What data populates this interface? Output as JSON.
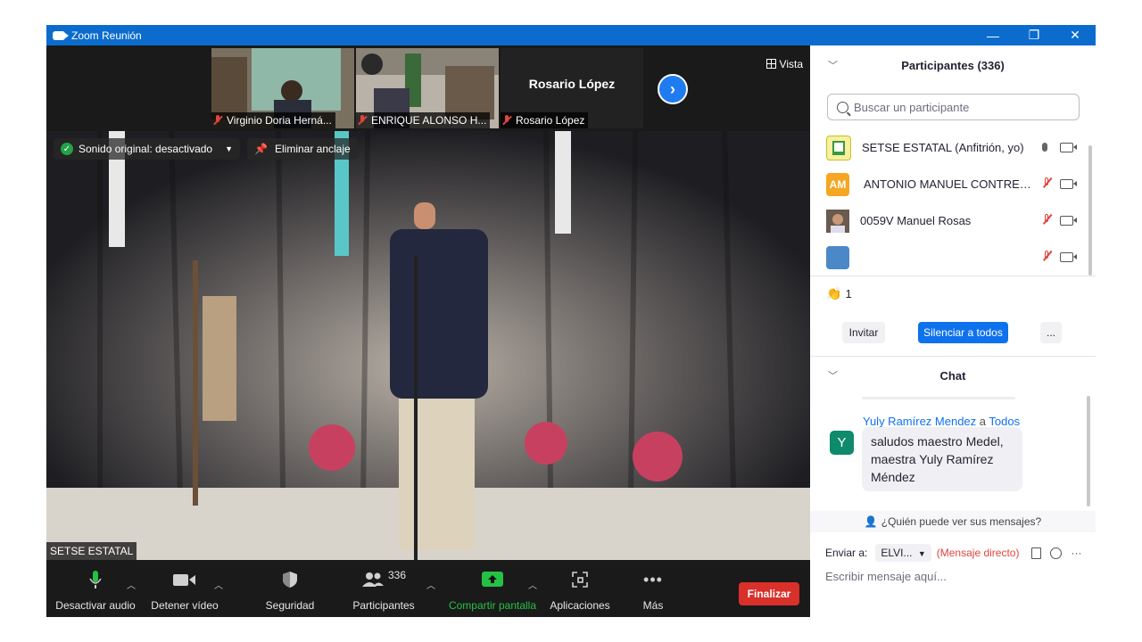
{
  "window": {
    "title": "Zoom Reunión",
    "controls": {
      "minimize": "—",
      "restore": "❐",
      "close": "✕"
    }
  },
  "strip": {
    "thumbnails": [
      {
        "name": "Virginio Doria Herná...",
        "muted": true
      },
      {
        "name": "ENRIQUE ALONSO H...",
        "muted": true
      },
      {
        "name": "Rosario López",
        "muted": true,
        "video_off": true
      }
    ],
    "next_icon": "chevron-right-icon",
    "view_label": "Vista"
  },
  "main_video": {
    "original_sound": "Sonido original: desactivado",
    "unpin_label": "Eliminar anclaje",
    "speaker_name": "SETSE ESTATAL"
  },
  "toolbar": {
    "mute_label": "Desactivar audio",
    "video_label": "Detener vídeo",
    "security_label": "Seguridad",
    "participants_label": "Participantes",
    "participants_count": "336",
    "share_label": "Compartir pantalla",
    "apps_label": "Aplicaciones",
    "more_label": "Más",
    "end_label": "Finalizar"
  },
  "participants": {
    "header": "Participantes (336)",
    "search_placeholder": "Buscar un participante",
    "rows": [
      {
        "name": "SETSE ESTATAL (Anfitrión, yo)",
        "avatar": "logo",
        "mic": "on",
        "video": "off"
      },
      {
        "name": "ANTONIO MANUEL CONTRERAS",
        "avatar_initials": "AM",
        "avatar_color": "#f5a623",
        "mic": "muted",
        "video": "off"
      },
      {
        "name": "0059V Manuel Rosas",
        "avatar": "photo",
        "mic": "muted",
        "video": "off"
      },
      {
        "name": "",
        "avatar": "photo",
        "mic": "muted",
        "video": "off"
      }
    ],
    "reaction_icon": "clapping-hands-icon",
    "reaction_count": "1",
    "invite_label": "Invitar",
    "mute_all_label": "Silenciar a todos",
    "more_label": "..."
  },
  "chat": {
    "header": "Chat",
    "message": {
      "sender": "Yuly Ramírez Mendez",
      "to_word": "a",
      "recipient": "Todos",
      "avatar_letter": "Y",
      "text": "saludos maestro Medel, maestra Yuly Ramírez Méndez"
    },
    "who_can_see": "¿Quién puede ver sus mensajes?",
    "send_to_label": "Enviar a:",
    "send_to_value": "ELVI...",
    "direct_label": "(Mensaje directo)",
    "input_placeholder": "Escribir mensaje aquí..."
  },
  "colors": {
    "titlebar": "#0b6ccd",
    "accent_blue": "#0e72ed",
    "end_red": "#d9302a",
    "share_green": "#24c145",
    "muted_red": "#e0443e"
  }
}
